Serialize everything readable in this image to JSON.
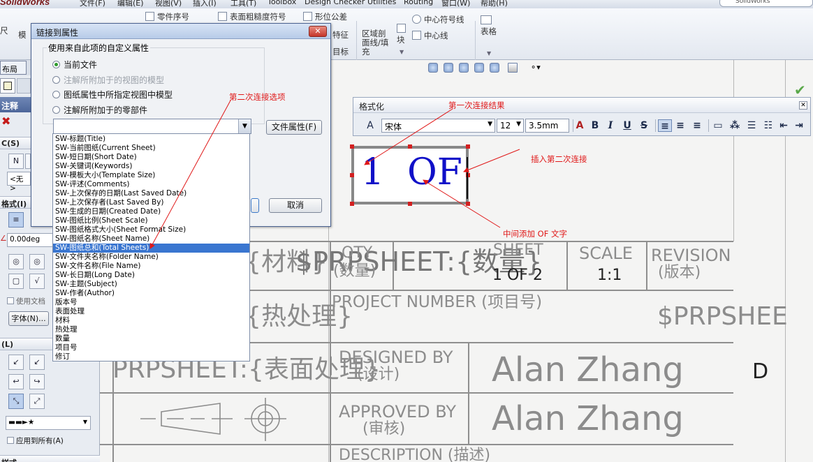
{
  "menubar": {
    "app_logo": "SolidWorks",
    "items": [
      "文件(F)",
      "编辑(E)",
      "视图(V)",
      "插入(I)",
      "工具(T)",
      "Toolbox",
      "Design Checker",
      "Utilities",
      "Routing",
      "窗口(W)",
      "帮助(H)"
    ],
    "search_placeholder": "SolidWorks"
  },
  "ribbon": {
    "partial_left_1": "尺",
    "partial_left_2": "模",
    "item_balloon": "零件序号",
    "item_surface": "表面粗糙度符号",
    "item_tolerance": "形位公差",
    "item_feature": "特征",
    "item_target": "目标",
    "item_section": "区域剖\n面线/填\n充",
    "item_block": "块",
    "item_center_mark": "中心符号线",
    "item_centerline": "中心线",
    "item_table": "表格"
  },
  "left_panel": {
    "tab_layout": "布局",
    "title": "注释",
    "section_c": "C(S)",
    "none_value": "<无>",
    "section_format": "格式(I)",
    "angle_value": "0.00deg",
    "use_doc_label": "使用文档",
    "font_button": "字体(N)...",
    "section_leader": "(L)",
    "apply_all_label": "应用到所有(A)",
    "section_bottom": "样式"
  },
  "dialog": {
    "title": "链接到属性",
    "group_label": "使用来自此项的自定义属性",
    "options": [
      {
        "label": "当前文件",
        "selected": true,
        "disabled": false
      },
      {
        "label": "注解所附加于的视图的模型",
        "selected": false,
        "disabled": true
      },
      {
        "label": "图纸属性中所指定视图中模型",
        "selected": false,
        "disabled": false
      },
      {
        "label": "注解所附加于的零部件",
        "selected": false,
        "disabled": false
      }
    ],
    "combo_value": "",
    "file_props_button": "文件属性(F)",
    "ok_button": "",
    "cancel_button": "取消",
    "dropdown_items": [
      "SW-标题(Title)",
      "SW-当前图纸(Current Sheet)",
      "SW-短日期(Short Date)",
      "SW-关键词(Keywords)",
      "SW-模板大小(Template Size)",
      "SW-评述(Comments)",
      "SW-上次保存的日期(Last Saved Date)",
      "SW-上次保存者(Last Saved By)",
      "SW-生成的日期(Created Date)",
      "SW-图纸比例(Sheet Scale)",
      "SW-图纸格式大小(Sheet Format Size)",
      "SW-图纸名称(Sheet Name)",
      "SW-图纸总和(Total Sheets)",
      "SW-文件夹名称(Folder Name)",
      "SW-文件名称(File Name)",
      "SW-长日期(Long Date)",
      "SW-主题(Subject)",
      "SW-作者(Author)",
      "版本号",
      "表面处理",
      "材料",
      "热处理",
      "数量",
      "项目号",
      "修订"
    ],
    "dropdown_selected_index": 12
  },
  "format_toolbar": {
    "title": "格式化",
    "font": "宋体",
    "size": "12",
    "height": "3.5mm",
    "icons": [
      "text-color-icon",
      "bold-icon",
      "italic-icon",
      "underline-icon",
      "strikethrough-icon",
      "align-left-icon",
      "align-center-icon",
      "align-right-icon",
      "frame-icon",
      "stack-icon",
      "bullets-icon",
      "numbering-icon",
      "indent-decrease-icon",
      "indent-increase-icon"
    ]
  },
  "text_box": {
    "content": "1  OF"
  },
  "title_block": {
    "row1_left": "T:{材料}",
    "row1_overlay": "$PRPSHEET:{数量}",
    "qty_label": "QTY",
    "qty_cn": "(数量)",
    "sheet_label": "SHEET",
    "sheet_value": "1 OF 2",
    "scale_label": "SCALE",
    "scale_value": "1:1",
    "revision_label": "REVISION",
    "revision_cn": "(版本)",
    "row2_left": "T:{热处理}",
    "project_label": "PROJECT  NUMBER (项目号)",
    "project_value": "$PRPSHEE",
    "row3_left": "PRPSHEET:{表面处理}",
    "designed_label": "DESIGNED BY",
    "designed_cn": "(设计)",
    "designer": "Alan Zhang",
    "size_letter": "D",
    "approved_label": "APPROVED BY",
    "approved_cn": "(审核)",
    "approver": "Alan Zhang",
    "description_label": "DESCRIPTION (描述)"
  },
  "annotations": {
    "second_link": "第二次连接选项",
    "first_result": "第一次连接结果",
    "insert_second": "插入第二次连接",
    "add_of": "中间添加 OF 文字"
  },
  "colors": {
    "annotation_red": "#e01818",
    "text_blue": "#1010c8",
    "selection_blue": "#3a76d0",
    "handle_red": "#d32020"
  }
}
